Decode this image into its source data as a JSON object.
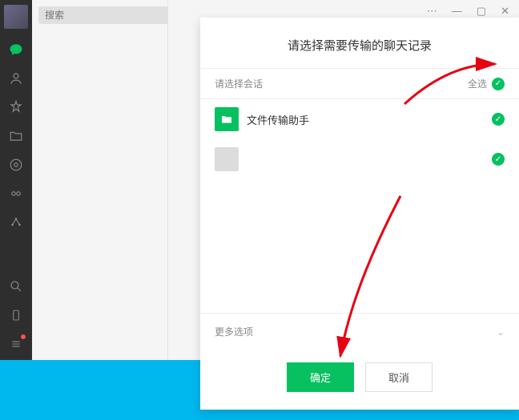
{
  "search": {
    "placeholder": "搜索"
  },
  "dialog": {
    "title": "请选择需要传输的聊天记录",
    "select_session_label": "请选择会话",
    "select_all_label": "全选",
    "more_options_label": "更多选项",
    "confirm_label": "确定",
    "cancel_label": "取消"
  },
  "conversations": {
    "0": {
      "name": "文件传输助手"
    },
    "1": {
      "name": "　　　"
    }
  }
}
